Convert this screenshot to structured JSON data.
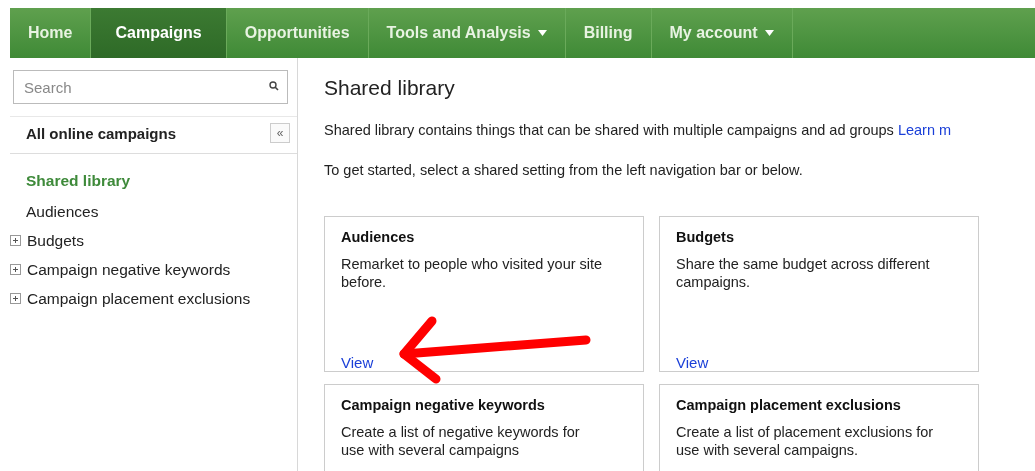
{
  "nav": [
    {
      "label": "Home",
      "selected": false,
      "dropdown": false
    },
    {
      "label": "Campaigns",
      "selected": true,
      "dropdown": false
    },
    {
      "label": "Opportunities",
      "selected": false,
      "dropdown": false
    },
    {
      "label": "Tools and Analysis",
      "selected": false,
      "dropdown": true
    },
    {
      "label": "Billing",
      "selected": false,
      "dropdown": false
    },
    {
      "label": "My account",
      "selected": false,
      "dropdown": true
    }
  ],
  "sidebar": {
    "search": {
      "placeholder": "Search"
    },
    "heading": "All online campaigns",
    "collapse_label": "«",
    "items": [
      {
        "label": "Shared library",
        "selected": true,
        "kind": "leaf"
      },
      {
        "label": "Audiences",
        "selected": false,
        "kind": "leaf"
      },
      {
        "label": "Budgets",
        "selected": false,
        "kind": "group",
        "expanded": false
      },
      {
        "label": "Campaign negative keywords",
        "selected": false,
        "kind": "group",
        "expanded": false
      },
      {
        "label": "Campaign placement exclusions",
        "selected": false,
        "kind": "group",
        "expanded": false
      }
    ]
  },
  "main": {
    "title": "Shared library",
    "intro": "Shared library contains things that can be shared with multiple campaigns and ad groups",
    "intro_link": "Learn m",
    "hint": "To get started, select a shared setting from the left navigation bar or below.",
    "cards": [
      {
        "title": "Audiences",
        "description": "Remarket to people who visited your site before.",
        "link": "View"
      },
      {
        "title": "Budgets",
        "description": "Share the same budget across different campaigns.",
        "link": "View"
      },
      {
        "title": "Campaign negative keywords",
        "description": "Create a list of negative keywords for use with several campaigns"
      },
      {
        "title": "Campaign placement exclusions",
        "description": "Create a list of placement exclusions for use with several campaigns."
      }
    ]
  },
  "annotation": {
    "kind": "arrow",
    "color": "#ff0000"
  }
}
